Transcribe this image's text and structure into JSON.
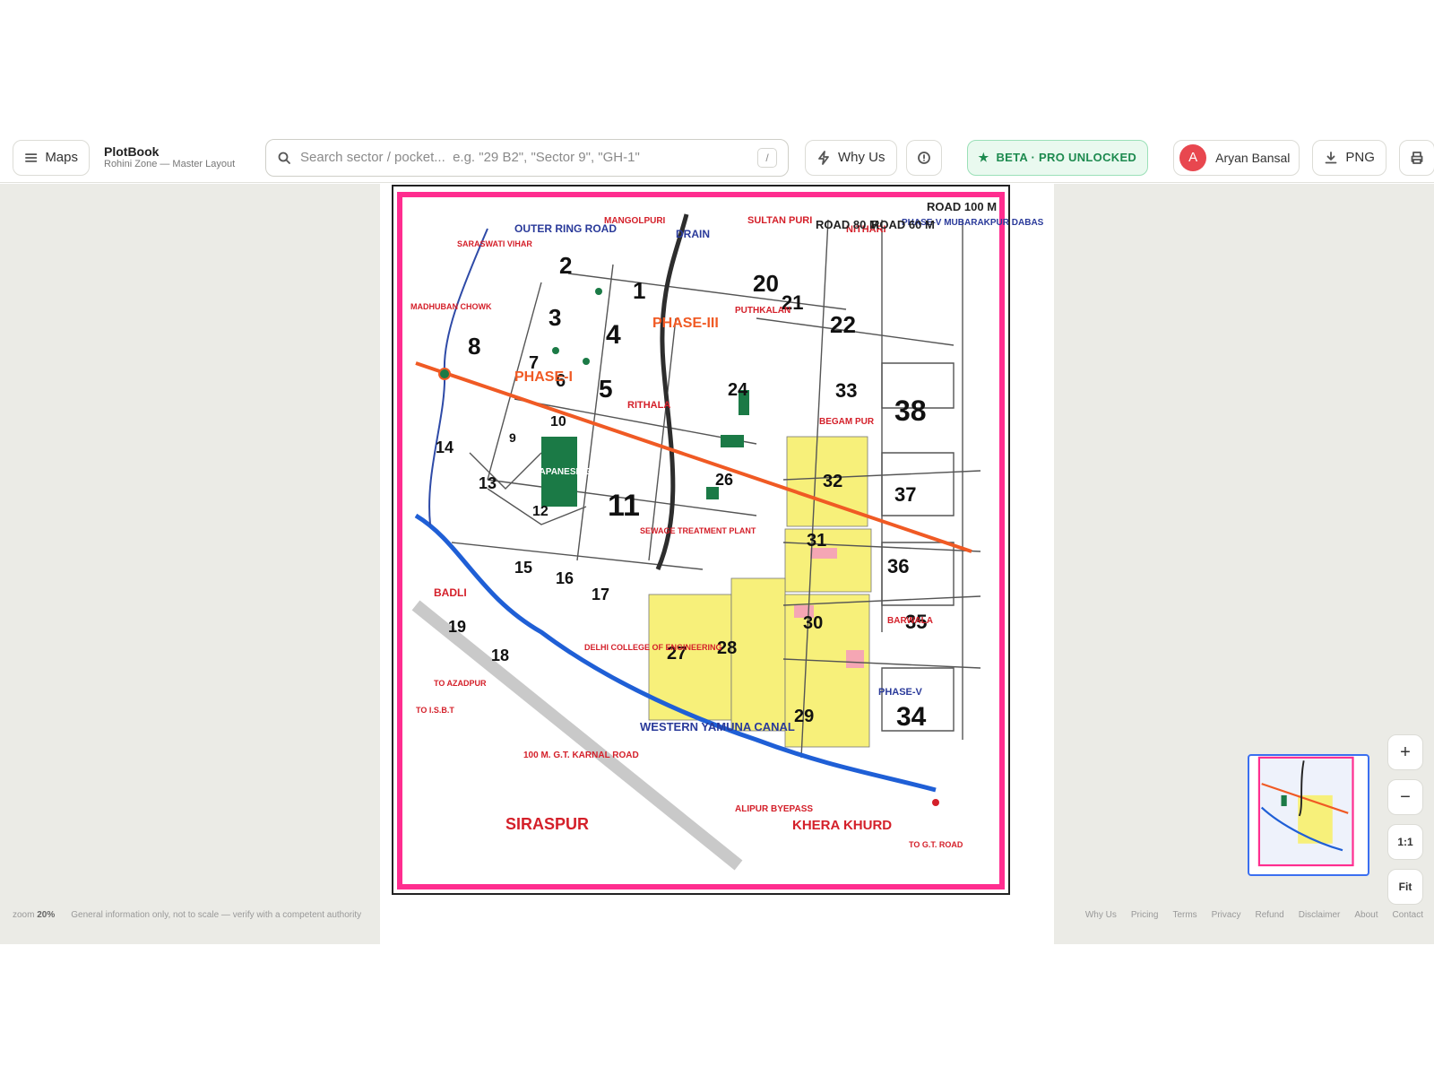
{
  "header": {
    "maps_label": "Maps",
    "brand_title": "PlotBook",
    "brand_subtitle": "Rohini Zone — Master Layout",
    "search_placeholder": "Search sector / pocket...  e.g. \"29 B2\", \"Sector 9\", \"GH-1\"",
    "search_shortcut": "/",
    "why_us_label": "Why Us",
    "beta_label": "BETA · PRO UNLOCKED",
    "user_initial": "A",
    "user_name": "Aryan Bansal",
    "png_label": "PNG"
  },
  "controls": {
    "zoom_in": "+",
    "zoom_out": "−",
    "one_to_one": "1:1",
    "fit": "Fit"
  },
  "status": {
    "zoom_label": "zoom",
    "zoom_value": "20%",
    "disclaimer": "General information only, not to scale — verify with a competent authority"
  },
  "footer": {
    "links": [
      "Why Us",
      "Pricing",
      "Terms",
      "Privacy",
      "Refund",
      "Disclaimer",
      "About",
      "Contact"
    ]
  },
  "map": {
    "sector_numbers": [
      "1",
      "2",
      "3",
      "4",
      "5",
      "6",
      "7",
      "8",
      "9",
      "10",
      "11",
      "12",
      "13",
      "14",
      "15",
      "16",
      "17",
      "18",
      "19",
      "20",
      "21",
      "22",
      "24",
      "26",
      "27",
      "28",
      "29",
      "30",
      "31",
      "32",
      "33",
      "34",
      "35",
      "36",
      "37",
      "38"
    ],
    "places": {
      "sultan_puri": "SULTAN PURI",
      "putkalan": "PUTHKALAN",
      "nithari": "NITHARI",
      "mubarakpur": "PHASE-V MUBARAKPUR DABAS",
      "mangolpuri": "MANGOLPURI",
      "saraswati_vihar": "SARASWATI VIHAR",
      "madhuban_chowk": "MADHUBAN CHOWK",
      "begampur": "BEGAM PUR",
      "rithala": "RITHALA",
      "japanese_garden": "JAPANESE GARDEN",
      "badli": "BADLI",
      "sirsapur": "SIRASPUR",
      "khera_khurd": "KHERA KHURD",
      "barwala": "BARWALA",
      "phase_v": "PHASE-V",
      "phase_iii": "PHASE-III",
      "phase_i": "PHASE-I",
      "dce": "DELHI COLLEGE OF ENGINEERING",
      "sewage": "SEWAGE TREATMENT PLANT"
    },
    "roads": {
      "outer_ring_road": "OUTER RING ROAD",
      "road_100m": "ROAD 100 M",
      "road_80m": "ROAD 80 M",
      "road_60m": "ROAD 60 M",
      "drain": "DRAIN",
      "gt_karnal_road": "100 M. G.T. KARNAL ROAD",
      "canal": "WESTERN YAMUNA CANAL",
      "alipur": "ALIPUR BYEPASS",
      "to_azadpur": "TO AZADPUR",
      "to_isbt": "TO I.S.B.T",
      "to_gt_road": "TO G.T. ROAD"
    }
  }
}
